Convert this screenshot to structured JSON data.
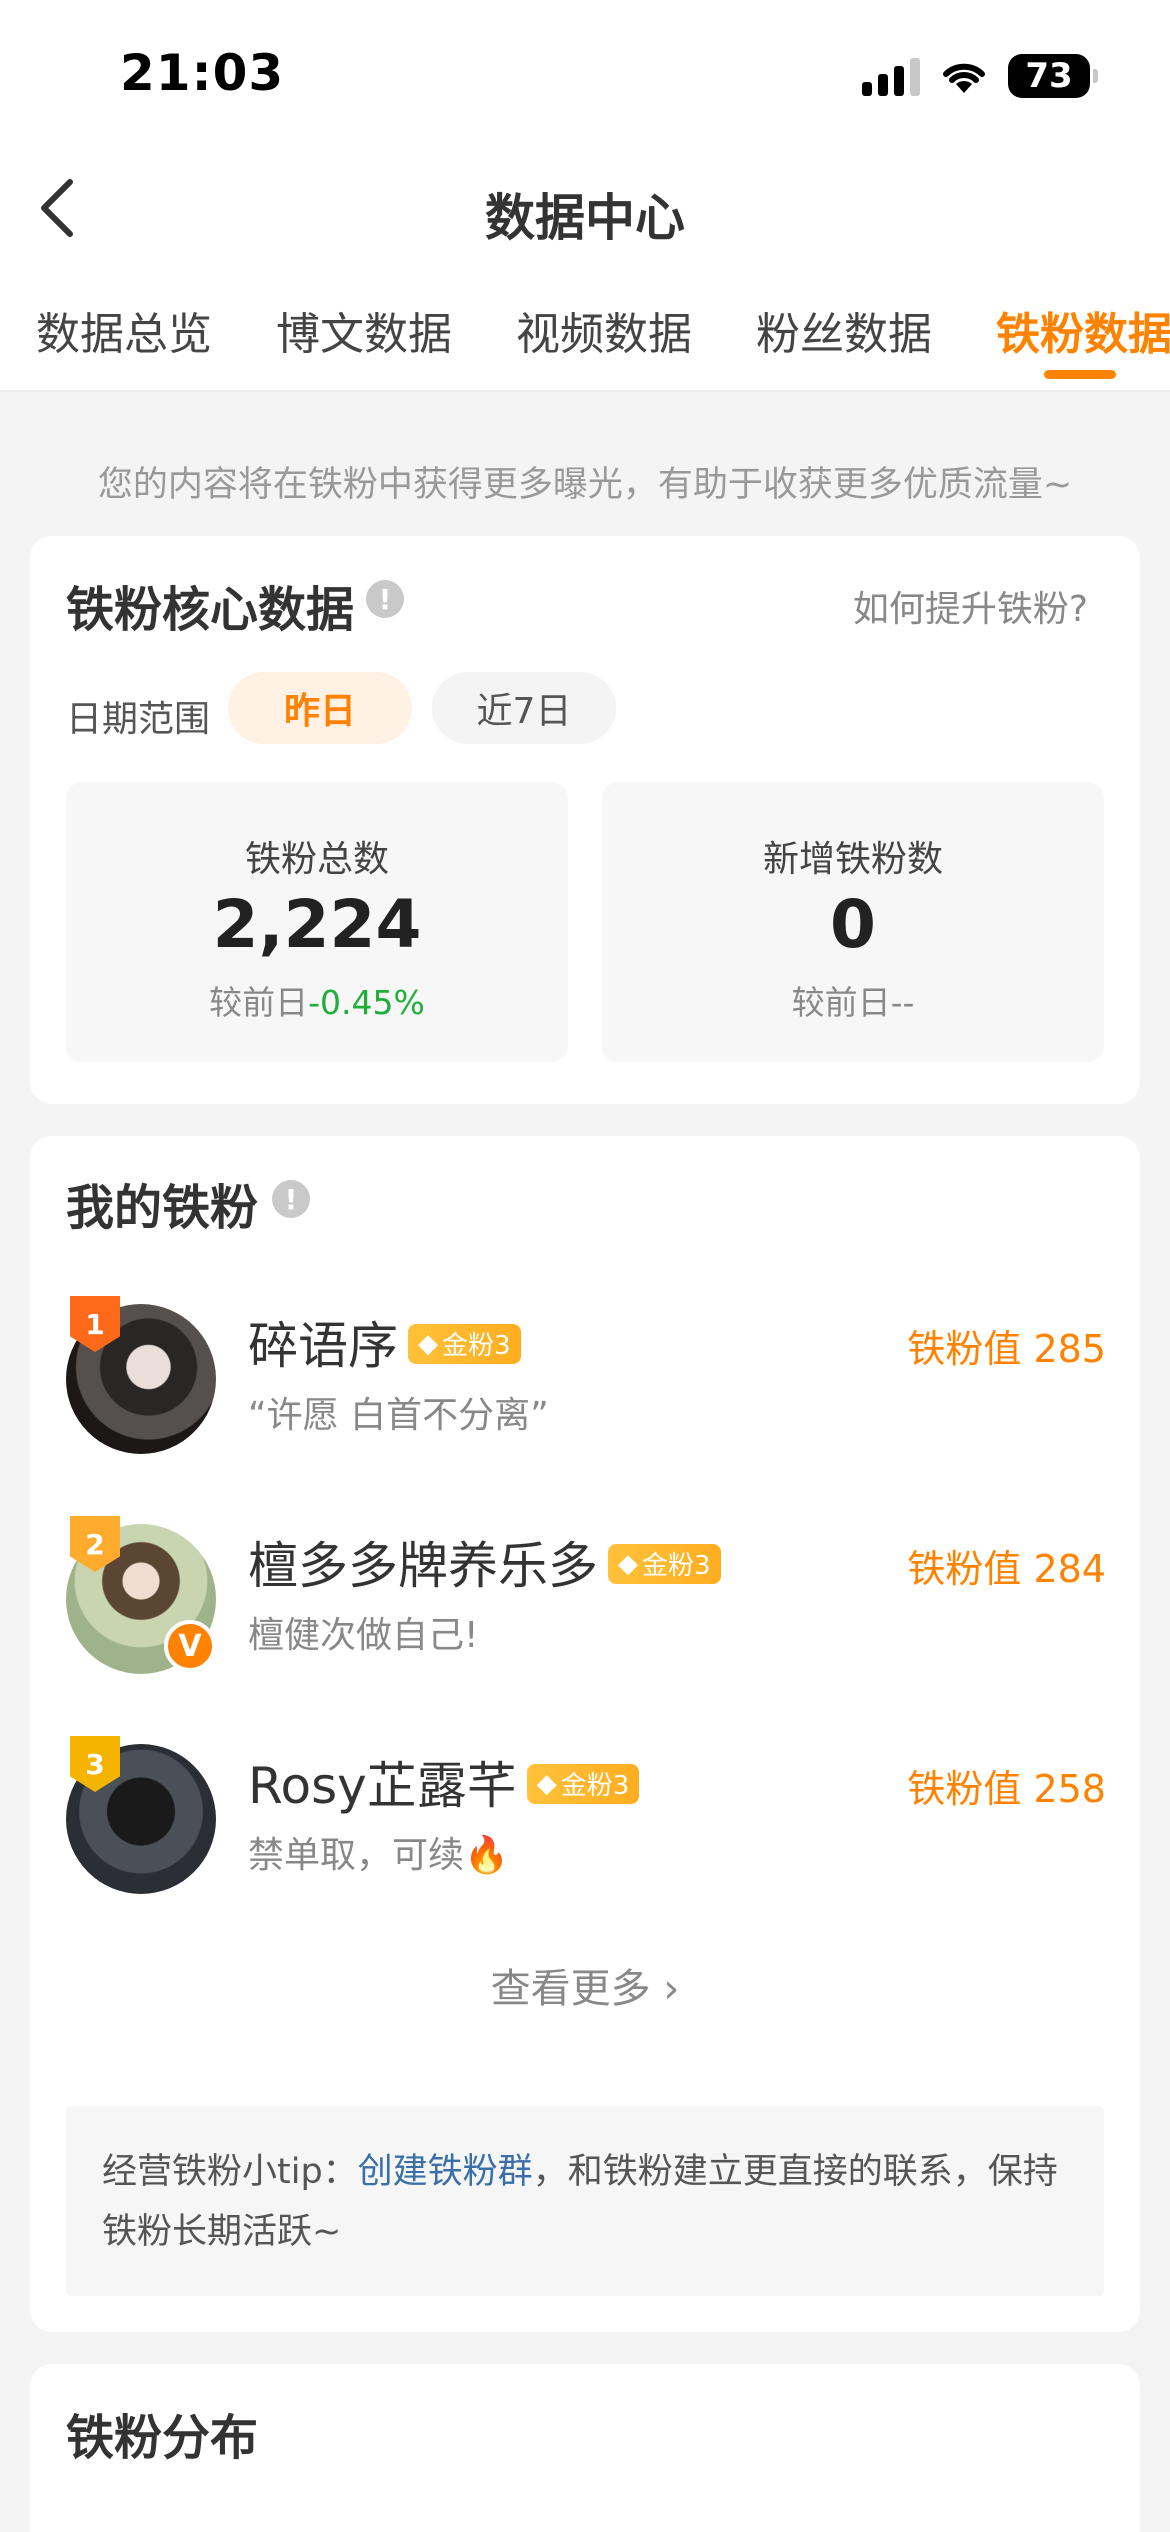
{
  "status_bar": {
    "time": "21:03",
    "battery": "73"
  },
  "header": {
    "title": "数据中心"
  },
  "tabs": [
    {
      "label": "数据总览",
      "active": false
    },
    {
      "label": "博文数据",
      "active": false
    },
    {
      "label": "视频数据",
      "active": false
    },
    {
      "label": "粉丝数据",
      "active": false
    },
    {
      "label": "铁粉数据",
      "active": true
    }
  ],
  "notice": "您的内容将在铁粉中获得更多曝光，有助于收获更多优质流量~",
  "core": {
    "title": "铁粉核心数据",
    "info": "!",
    "help_link": "如何提升铁粉?",
    "date_label": "日期范围",
    "date_options": [
      "昨日",
      "近7日"
    ],
    "stats": [
      {
        "label": "铁粉总数",
        "value": "2,224",
        "compare_prefix": "较前日",
        "compare_value": "-0.45%"
      },
      {
        "label": "新增铁粉数",
        "value": "0",
        "compare_prefix": "较前日",
        "compare_value": "--"
      }
    ]
  },
  "my_fans": {
    "title": "我的铁粉",
    "info": "!",
    "fans": [
      {
        "rank": "1",
        "name": "碎语序",
        "badge": "金粉3",
        "signature": "“许愿 白首不分离”",
        "value": "铁粉值 285",
        "verified": ""
      },
      {
        "rank": "2",
        "name": "檀多多牌养乐多",
        "badge": "金粉3",
        "signature": "檀健次做自己!",
        "value": "铁粉值 284",
        "verified": "V"
      },
      {
        "rank": "3",
        "name": "Rosy芷露芊",
        "badge": "金粉3",
        "signature": "禁单取，可续🔥",
        "value": "铁粉值 258",
        "verified": ""
      }
    ],
    "more": "查看更多",
    "tip_prefix": "经营铁粉小tip：",
    "tip_link": "创建铁粉群",
    "tip_suffix": "，和铁粉建立更直接的联系，保持铁粉长期活跃~"
  },
  "distribution": {
    "title": "铁粉分布"
  },
  "colors": {
    "accent": "#ff8200",
    "negative": "#1fae3b",
    "link": "#3a6fa8"
  }
}
